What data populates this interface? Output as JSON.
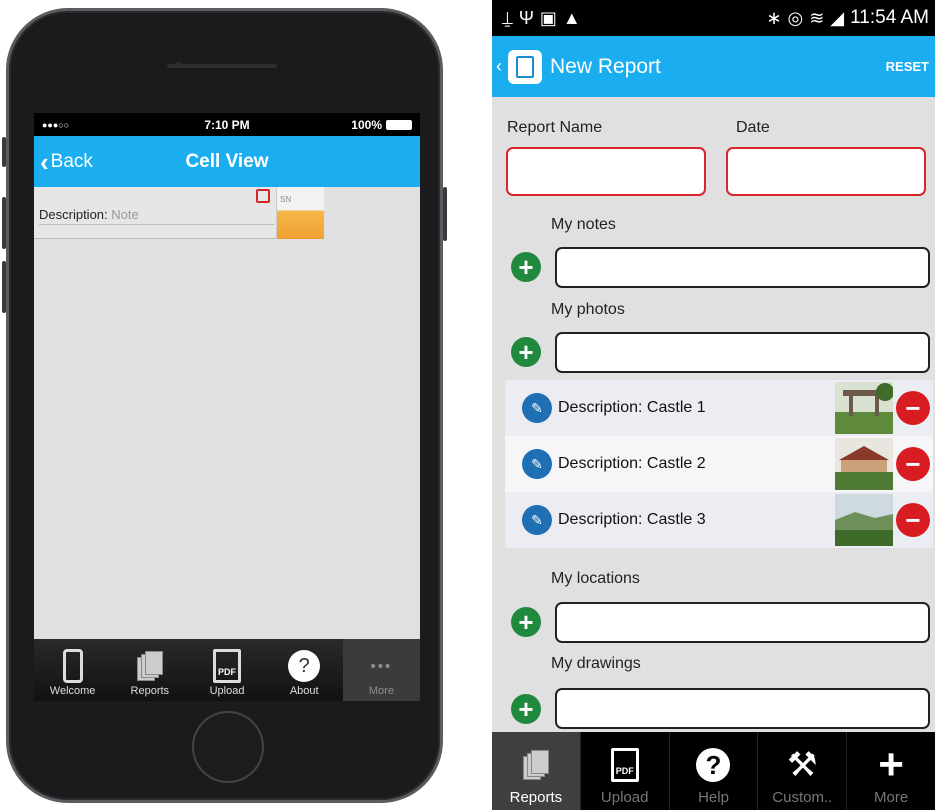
{
  "ios": {
    "status": {
      "signal": "●●●○○",
      "time": "7:10 PM",
      "battery": "100%"
    },
    "nav": {
      "back_label": "Back",
      "title": "Cell View"
    },
    "cell": {
      "label": "Description:",
      "value": "Note",
      "thumb_text": "SN"
    },
    "tabs": [
      {
        "label": "Welcome",
        "icon": "phone-icon"
      },
      {
        "label": "Reports",
        "icon": "reports-icon"
      },
      {
        "label": "Upload",
        "icon": "pdf-icon",
        "icon_text": "PDF"
      },
      {
        "label": "About",
        "icon": "help-icon",
        "icon_text": "?"
      },
      {
        "label": "More",
        "icon": "more-dots-icon",
        "icon_text": "•••"
      }
    ]
  },
  "android": {
    "status": {
      "time": "11:54 AM"
    },
    "bar": {
      "title": "New Report",
      "reset_label": "RESET"
    },
    "form": {
      "report_name_label": "Report Name",
      "date_label": "Date",
      "notes_label": "My notes",
      "photos_label": "My photos",
      "locations_label": "My locations",
      "drawings_label": "My drawings"
    },
    "photos": [
      {
        "description": "Description: Castle 1"
      },
      {
        "description": "Description: Castle 2"
      },
      {
        "description": "Description: Castle 3"
      }
    ],
    "tabs": [
      {
        "label": "Reports",
        "icon": "reports-icon"
      },
      {
        "label": "Upload",
        "icon": "pdf-icon",
        "icon_text": "PDF"
      },
      {
        "label": "Help",
        "icon": "help-icon",
        "icon_text": "?"
      },
      {
        "label": "Custom..",
        "icon": "tools-icon"
      },
      {
        "label": "More",
        "icon": "plus-icon",
        "icon_text": "+"
      }
    ]
  },
  "colors": {
    "accent": "#1aaef0",
    "add_green": "#1f8a3e",
    "remove_red": "#d71d22",
    "required_red": "#d7262c"
  }
}
